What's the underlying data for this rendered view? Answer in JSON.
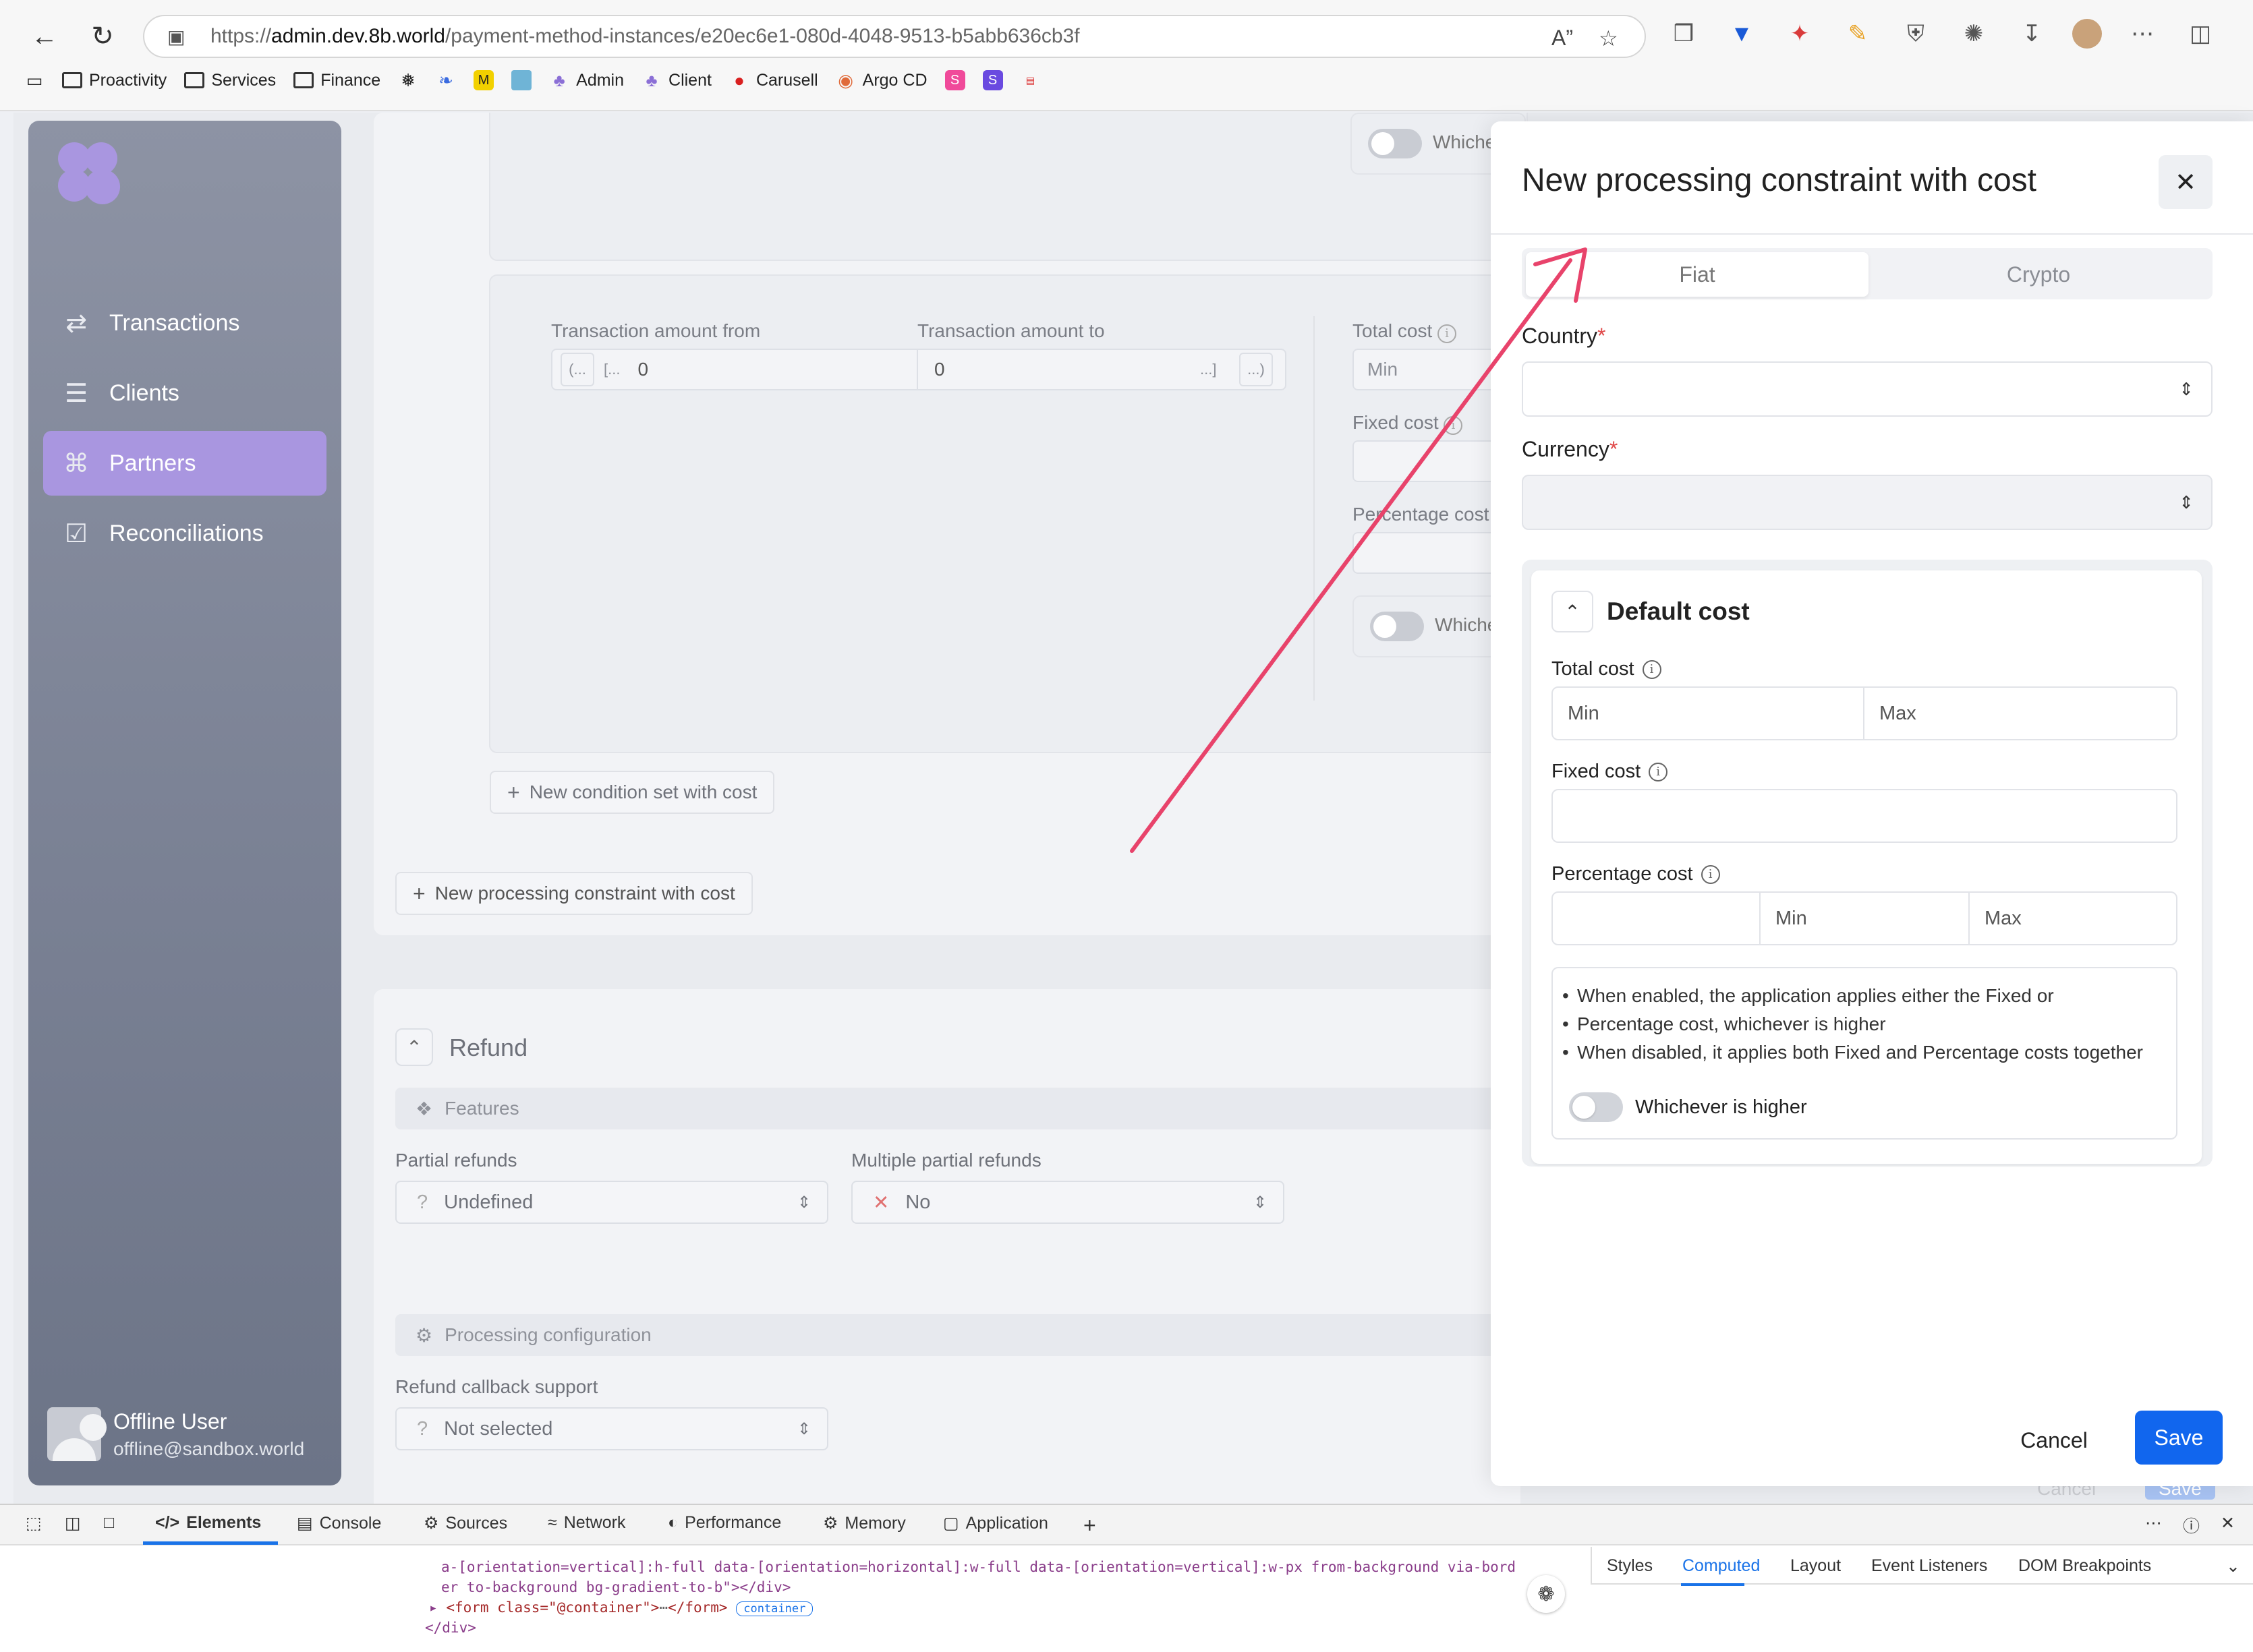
{
  "browser": {
    "url_prefix": "https://",
    "url_host": "admin.dev.8b.world",
    "url_path": "/payment-method-instances/e20ec6e1-080d-4048-9513-b5abb636cb3f",
    "bookmarks": [
      "Proactivity",
      "Services",
      "Finance",
      "Admin",
      "Client",
      "Carusell",
      "Argo CD"
    ]
  },
  "sidebar": {
    "items": [
      {
        "label": "Transactions",
        "icon": "arrows-swap-icon"
      },
      {
        "label": "Clients",
        "icon": "stack-icon"
      },
      {
        "label": "Partners",
        "icon": "network-icon"
      },
      {
        "label": "Reconciliations",
        "icon": "checklist-icon"
      }
    ],
    "active": "Partners",
    "user": {
      "name": "Offline User",
      "email": "offline@sandbox.world"
    }
  },
  "background": {
    "whichever_truncated": "Whiche",
    "whichever_truncated2": "Whichev",
    "amount_from_label": "Transaction amount from",
    "amount_to_label": "Transaction amount to",
    "amount_from_prefix1": "(...",
    "amount_from_prefix2": "[...",
    "amount_from_value": "0",
    "amount_to_value": "0",
    "amount_to_suffix1": "...]",
    "amount_to_suffix2": "...)",
    "total_cost_label": "Total cost",
    "min_placeholder": "Min",
    "fixed_cost_label": "Fixed cost",
    "percentage_cost_label": "Percentage cost",
    "new_condition_button": "New condition set with cost",
    "new_constraint_button": "New processing constraint with cost",
    "refund_title": "Refund",
    "features_label": "Features",
    "partial_refunds_label": "Partial refunds",
    "partial_refunds_value": "Undefined",
    "multiple_partial_label": "Multiple partial refunds",
    "multiple_partial_value": "No",
    "processing_config_label": "Processing configuration",
    "refund_callback_label": "Refund callback support",
    "refund_callback_value": "Not selected",
    "bottom_cancel": "Cancel",
    "bottom_save": "Save"
  },
  "drawer": {
    "title": "New processing constraint with cost",
    "tabs": [
      "Fiat",
      "Crypto"
    ],
    "active_tab": "Fiat",
    "country_label": "Country",
    "currency_label": "Currency",
    "required_mark": "*",
    "default_cost_title": "Default cost",
    "total_cost_label": "Total cost",
    "min_placeholder": "Min",
    "max_placeholder": "Max",
    "fixed_cost_label": "Fixed cost",
    "percentage_cost_label": "Percentage cost",
    "note_line_1": "When enabled, the application applies either the Fixed or",
    "note_line_1b": "Percentage cost, whichever is higher",
    "note_line_2": "When disabled, it applies both Fixed and Percentage costs together",
    "toggle_label": "Whichever is higher",
    "toggle_on": false,
    "cancel_label": "Cancel",
    "save_label": "Save",
    "save_color": "#1166ee"
  },
  "devtools": {
    "tabs": [
      "Elements",
      "Console",
      "Sources",
      "Network",
      "Performance",
      "Memory",
      "Application"
    ],
    "active_tab": "Elements",
    "code_1": "a-[orientation=vertical]:h-full data-[orientation=horizontal]:w-full data-[orientation=vertical]:w-px from-background via-bord",
    "code_2": "er to-background bg-gradient-to-b\"></div>",
    "code_3_tag": "<form class=\"@container\">",
    "code_3_end": "</form>",
    "code_3_badge": "container",
    "code_4": "</div>",
    "side_tabs": [
      "Styles",
      "Computed",
      "Layout",
      "Event Listeners",
      "DOM Breakpoints"
    ],
    "side_active": "Computed"
  },
  "colors": {
    "accent": "#a996e0",
    "arrow": "#e8436b"
  }
}
